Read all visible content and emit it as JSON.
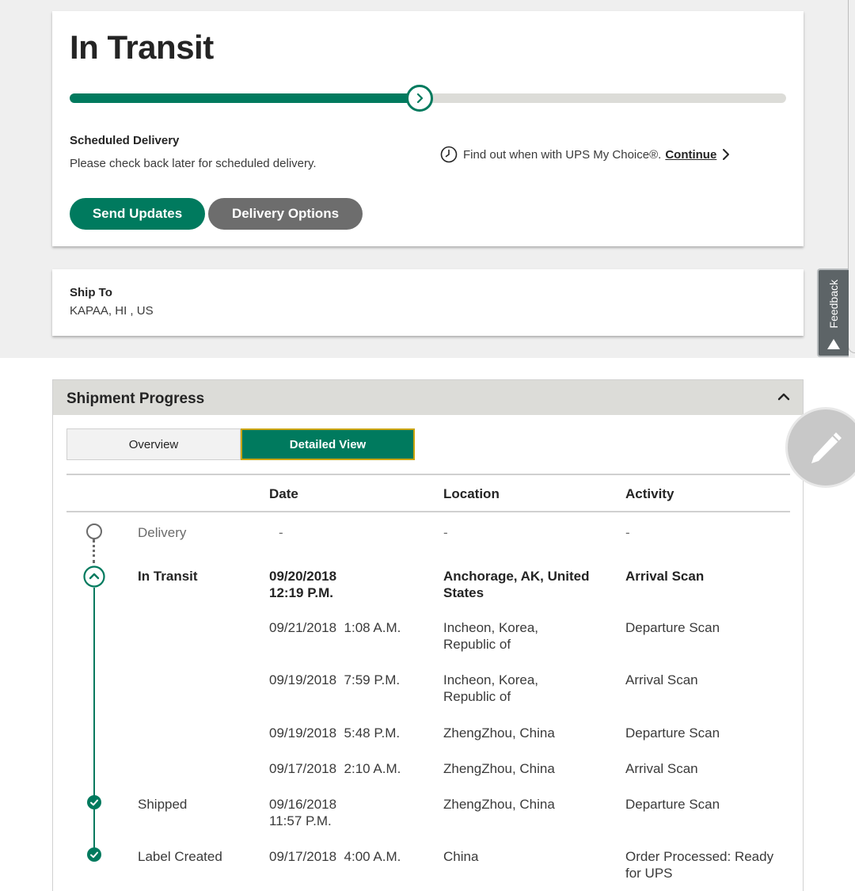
{
  "status_card": {
    "title": "In Transit",
    "progress_fraction": 0.488,
    "scheduled_label": "Scheduled Delivery",
    "scheduled_message": "Please check back later for scheduled delivery.",
    "mychoice_text": "Find out when with UPS My Choice®.",
    "continue_label": "Continue",
    "send_updates_label": "Send Updates",
    "delivery_options_label": "Delivery Options"
  },
  "ship_to": {
    "label": "Ship To",
    "value": "KAPAA, HI , US"
  },
  "feedback": {
    "label": "Feedback"
  },
  "shipment_progress": {
    "title": "Shipment Progress",
    "tabs": {
      "overview": "Overview",
      "detailed": "Detailed View"
    },
    "columns": {
      "date": "Date",
      "location": "Location",
      "activity": "Activity"
    },
    "rows": [
      {
        "status": "Delivery",
        "date": "-",
        "location": "-",
        "activity": "-"
      },
      {
        "status": "In Transit",
        "date": "09/20/2018\n12:19 P.M.",
        "location": "Anchorage, AK, United\nStates",
        "activity": "Arrival Scan"
      },
      {
        "status": "",
        "date": "09/21/2018  1:08 A.M.",
        "location": "Incheon, Korea,\nRepublic of",
        "activity": "Departure Scan"
      },
      {
        "status": "",
        "date": "09/19/2018  7:59 P.M.",
        "location": "Incheon, Korea,\nRepublic of",
        "activity": "Arrival Scan"
      },
      {
        "status": "",
        "date": "09/19/2018  5:48 P.M.",
        "location": "ZhengZhou, China",
        "activity": "Departure Scan"
      },
      {
        "status": "",
        "date": "09/17/2018  2:10 A.M.",
        "location": "ZhengZhou, China",
        "activity": "Arrival Scan"
      },
      {
        "status": "Shipped",
        "date": "09/16/2018\n11:57 P.M.",
        "location": "ZhengZhou, China",
        "activity": "Departure Scan"
      },
      {
        "status": "Label Created",
        "date": "09/17/2018  4:00 A.M.",
        "location": "China",
        "activity": "Order Processed: Ready\nfor UPS"
      }
    ]
  },
  "colors": {
    "ups_green": "#007a5e",
    "button_gray": "#6d6d6d",
    "tab_border_gold": "#c9a40a",
    "header_gray": "#dcdcd8"
  },
  "icons": {
    "progress_knob": "chevron-right-icon",
    "clock": "clock-icon",
    "continue_arrow": "chevron-right-icon",
    "collapse": "chevron-up-icon",
    "edit": "pencil-icon",
    "feedback": "triangle-up-icon"
  }
}
